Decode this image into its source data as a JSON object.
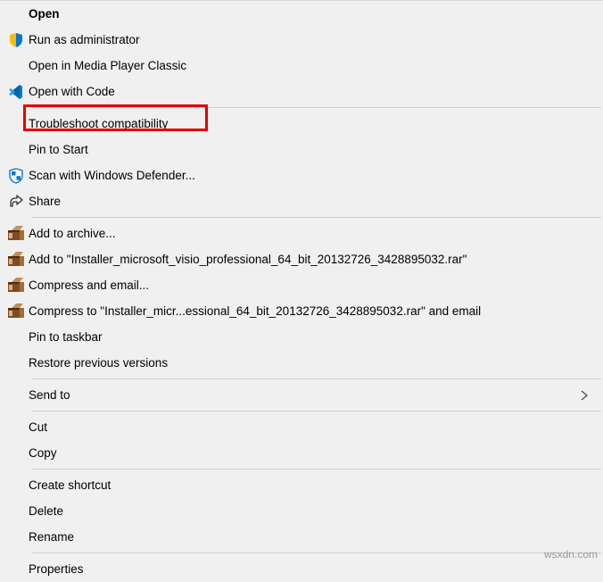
{
  "menu": {
    "open": "Open",
    "run_admin": "Run as administrator",
    "open_mpc": "Open in Media Player Classic",
    "open_code": "Open with Code",
    "troubleshoot": "Troubleshoot compatibility",
    "pin_start": "Pin to Start",
    "scan_defender": "Scan with Windows Defender...",
    "share": "Share",
    "add_archive": "Add to archive...",
    "add_to_rar": "Add to \"Installer_microsoft_visio_professional_64_bit_20132726_3428895032.rar\"",
    "compress_email": "Compress and email...",
    "compress_to_email": "Compress to \"Installer_micr...essional_64_bit_20132726_3428895032.rar\" and email",
    "pin_taskbar": "Pin to taskbar",
    "restore_versions": "Restore previous versions",
    "send_to": "Send to",
    "cut": "Cut",
    "copy": "Copy",
    "create_shortcut": "Create shortcut",
    "delete": "Delete",
    "rename": "Rename",
    "properties": "Properties"
  },
  "watermark": "wsxdn.com"
}
